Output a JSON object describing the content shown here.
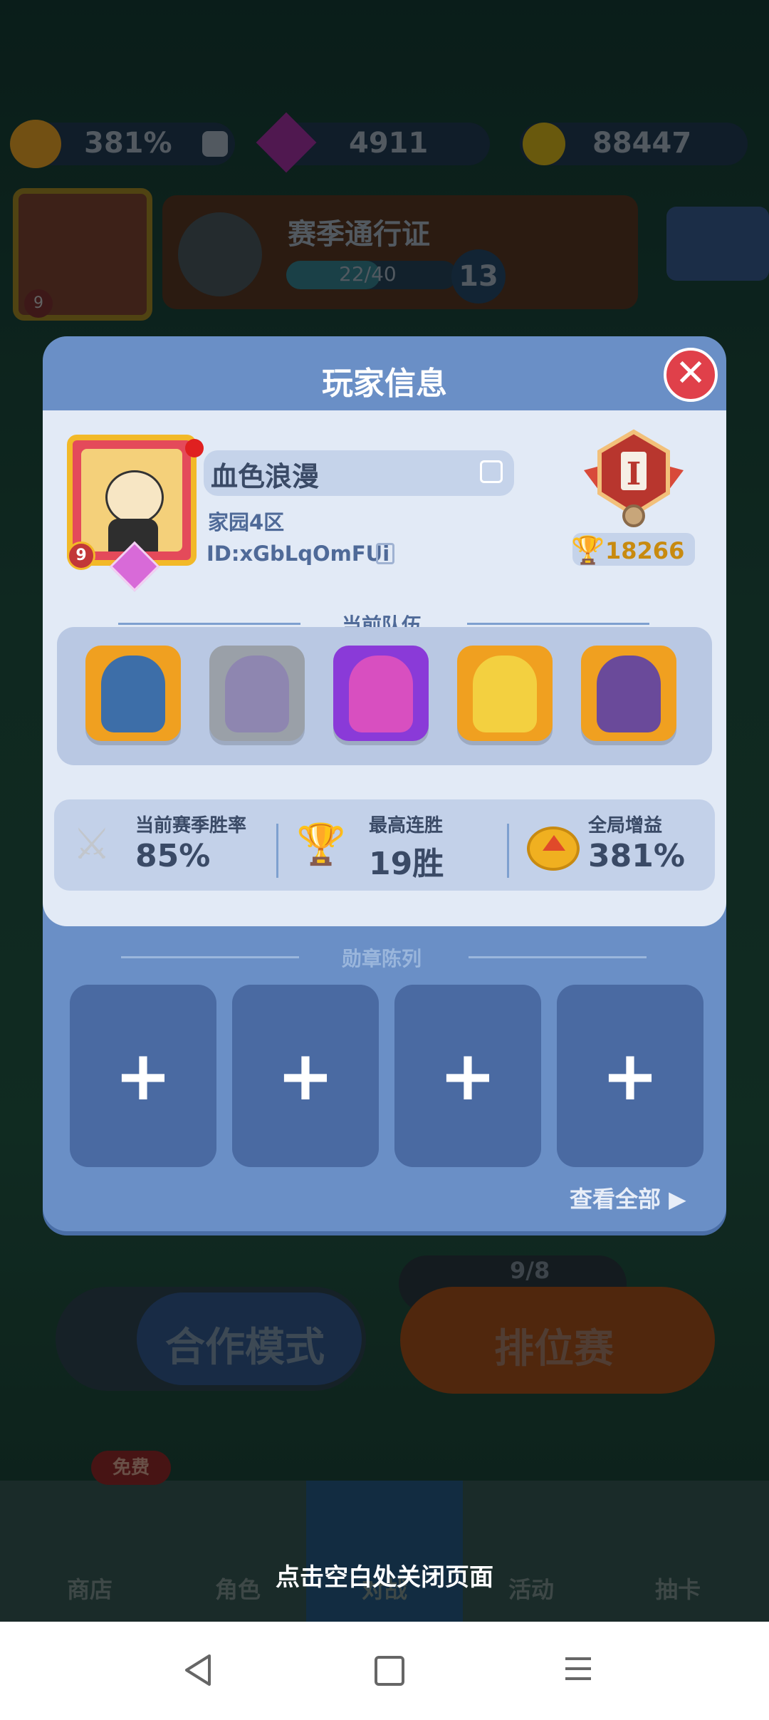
{
  "topbar": {
    "boost_percent": "381%",
    "gems": "4911",
    "coins": "88447"
  },
  "season_pass": {
    "title": "赛季通行证",
    "progress_text": "22/40",
    "progress": 0.55,
    "level": "13",
    "avatar_level": "9"
  },
  "main_buttons": {
    "coop": "合作模式",
    "ranked": "排位赛",
    "ticket": "9/8"
  },
  "bottom_nav": {
    "free_badge": "免费",
    "items": [
      "商店",
      "角色",
      "对战",
      "活动",
      "抽卡"
    ]
  },
  "modal": {
    "title": "玩家信息",
    "close_icon": "close-icon",
    "player": {
      "name": "血色浪漫",
      "server": "家园4区",
      "id": "ID:xGbLqOmFUi",
      "avatar_level": "9",
      "rank_letter": "I",
      "trophies": "18266"
    },
    "team_title": "当前队伍",
    "team": [
      {
        "name": "ice-golem-hero",
        "bg": "#f0a020",
        "body": "#3d6ea8"
      },
      {
        "name": "gray-ninja-hero",
        "bg": "#9aa0a8",
        "body": "#8e86b0"
      },
      {
        "name": "pink-brute-hero",
        "bg": "#8a3ad8",
        "body": "#d84fc0"
      },
      {
        "name": "golden-warrior-hero",
        "bg": "#f0a020",
        "body": "#f3d040"
      },
      {
        "name": "dark-knight-hero",
        "bg": "#f0a020",
        "body": "#6a4a9a"
      }
    ],
    "stats": {
      "winrate_label": "当前赛季胜率",
      "winrate_value": "85%",
      "streak_label": "最高连胜",
      "streak_value": "19胜",
      "boost_label": "全局增益",
      "boost_value": "381%"
    },
    "medals_title": "勋章陈列",
    "medal_slots": [
      "+",
      "+",
      "+",
      "+"
    ],
    "see_all": "查看全部 ▶"
  },
  "close_hint": "点击空白处关闭页面",
  "colors": {
    "modal_header": "#6a8fc6",
    "card_bg": "#e2eaf6",
    "accent_red": "#e0404a",
    "gold": "#f2b928"
  }
}
